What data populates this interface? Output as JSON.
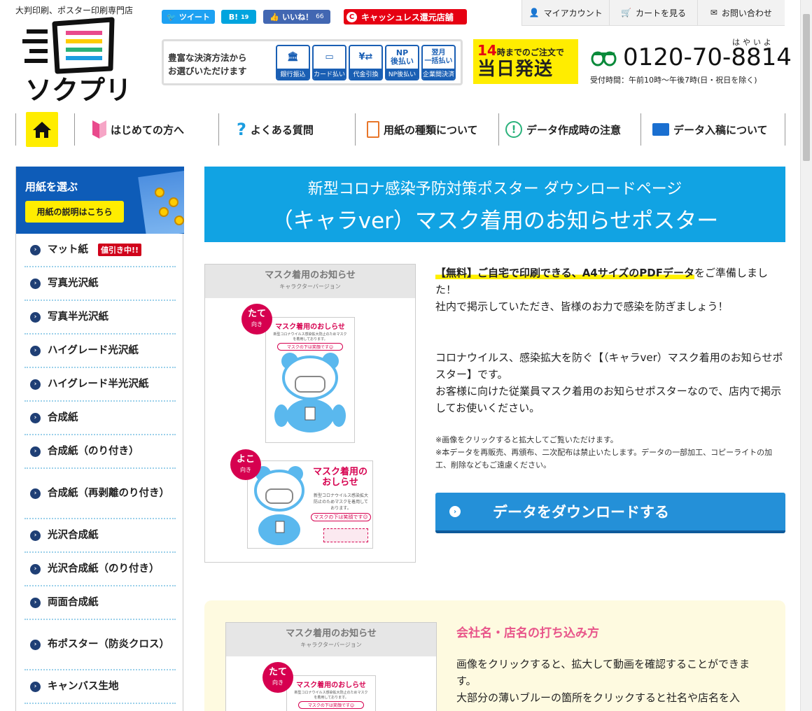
{
  "header": {
    "tagline": "大判印刷、ポスター印刷専門店",
    "logo_text": "ソクプリ",
    "social": {
      "tweet": "ツイート",
      "hatena": "B!",
      "hatena_count": "19",
      "like": "いいね！",
      "like_count": "66"
    },
    "cashless": "キャッシュレス還元店舗",
    "top_links": [
      "マイアカウント",
      "カートを見る",
      "お問い合わせ"
    ],
    "payment": {
      "text_line1": "豊富な決済方法から",
      "text_line2": "お選びいただけます",
      "methods": [
        {
          "label": "銀行振込",
          "symbol": "🏛"
        },
        {
          "label": "カード払い",
          "symbol": "▭"
        },
        {
          "label": "代金引換",
          "symbol": "¥⇄"
        },
        {
          "label": "NP後払い",
          "symbol": "NP\n後払い"
        },
        {
          "label": "企業間決済",
          "symbol": "翌月\n一括払い"
        }
      ]
    },
    "same_day": {
      "hour": "14",
      "line1": "時までのご注文で",
      "line2": "当日発送"
    },
    "phone": "0120-70-8814",
    "phone_kana": "はやいよ",
    "hours": "受付時間：午前10時〜午後7時(日・祝日を除く)"
  },
  "nav": [
    "はじめての方へ",
    "よくある質問",
    "用紙の種類について",
    "データ作成時の注意",
    "データ入稿について"
  ],
  "sidebar": {
    "title": "用紙を選ぶ",
    "button": "用紙の説明はこちら",
    "badge": "値引き中!!",
    "items": [
      "マット紙",
      "写真光沢紙",
      "写真半光沢紙",
      "ハイグレード光沢紙",
      "ハイグレード半光沢紙",
      "合成紙",
      "合成紙（のり付き）",
      "合成紙（再剥離のり付き）",
      "光沢合成紙",
      "光沢合成紙（のり付き）",
      "両面合成紙",
      "布ポスター（防炎クロス）",
      "キャンバス生地"
    ]
  },
  "banner": {
    "sub": "新型コロナ感染予防対策ポスター ダウンロードページ",
    "main": "（キャラver）マスク着用のお知らせポスター"
  },
  "poster": {
    "head": "マスク着用のお知らせ",
    "head_sub": "キャラクターバージョン",
    "tate": "たて",
    "yoko": "よこ",
    "muki": "向き",
    "sheet_title": "マスク着用のおしらせ",
    "sheet_title_yoko_1": "マスク着用の",
    "sheet_title_yoko_2": "おしらせ",
    "sheet_text": "新型コロナウイルス感染拡大防止のためマスクを着用しております。",
    "sheet_smile": "マスクの下は笑顔です☺"
  },
  "content": {
    "highlight": "【無料】ご自宅で印刷できる、A4サイズのPDFデータ",
    "p1_rest": "をご準備しました！",
    "p1_line2": "社内で掲示していただき、皆様のお力で感染を防ぎましょう！",
    "p2_line1": "コロナウイルス、感染拡大を防ぐ【（キャラver）マスク着用のお知らせポスター】です。",
    "p2_line2": "お客様に向けた従業員マスク着用のお知らせポスターなので、店内で掲示してお使いください。",
    "note1": "※画像をクリックすると拡大してご覧いただけます。",
    "note2": "※本データを再販売、再頒布、二次配布は禁止いたします。データの一部加工、コピーライトの加工、削除などもご遠慮ください。",
    "download": "データをダウンロードする"
  },
  "section2": {
    "title": "会社名・店名の打ち込み方",
    "text1": "画像をクリックすると、拡大して動画を確認することができます。",
    "text2": "大部分の薄いブルーの箇所をクリックすると社名や店名を入"
  },
  "colors": {
    "brand_blue": "#11a3e3",
    "nav_blue": "#0e5cb8",
    "accent_yellow": "#ffed00",
    "accent_pink": "#d6004f"
  }
}
